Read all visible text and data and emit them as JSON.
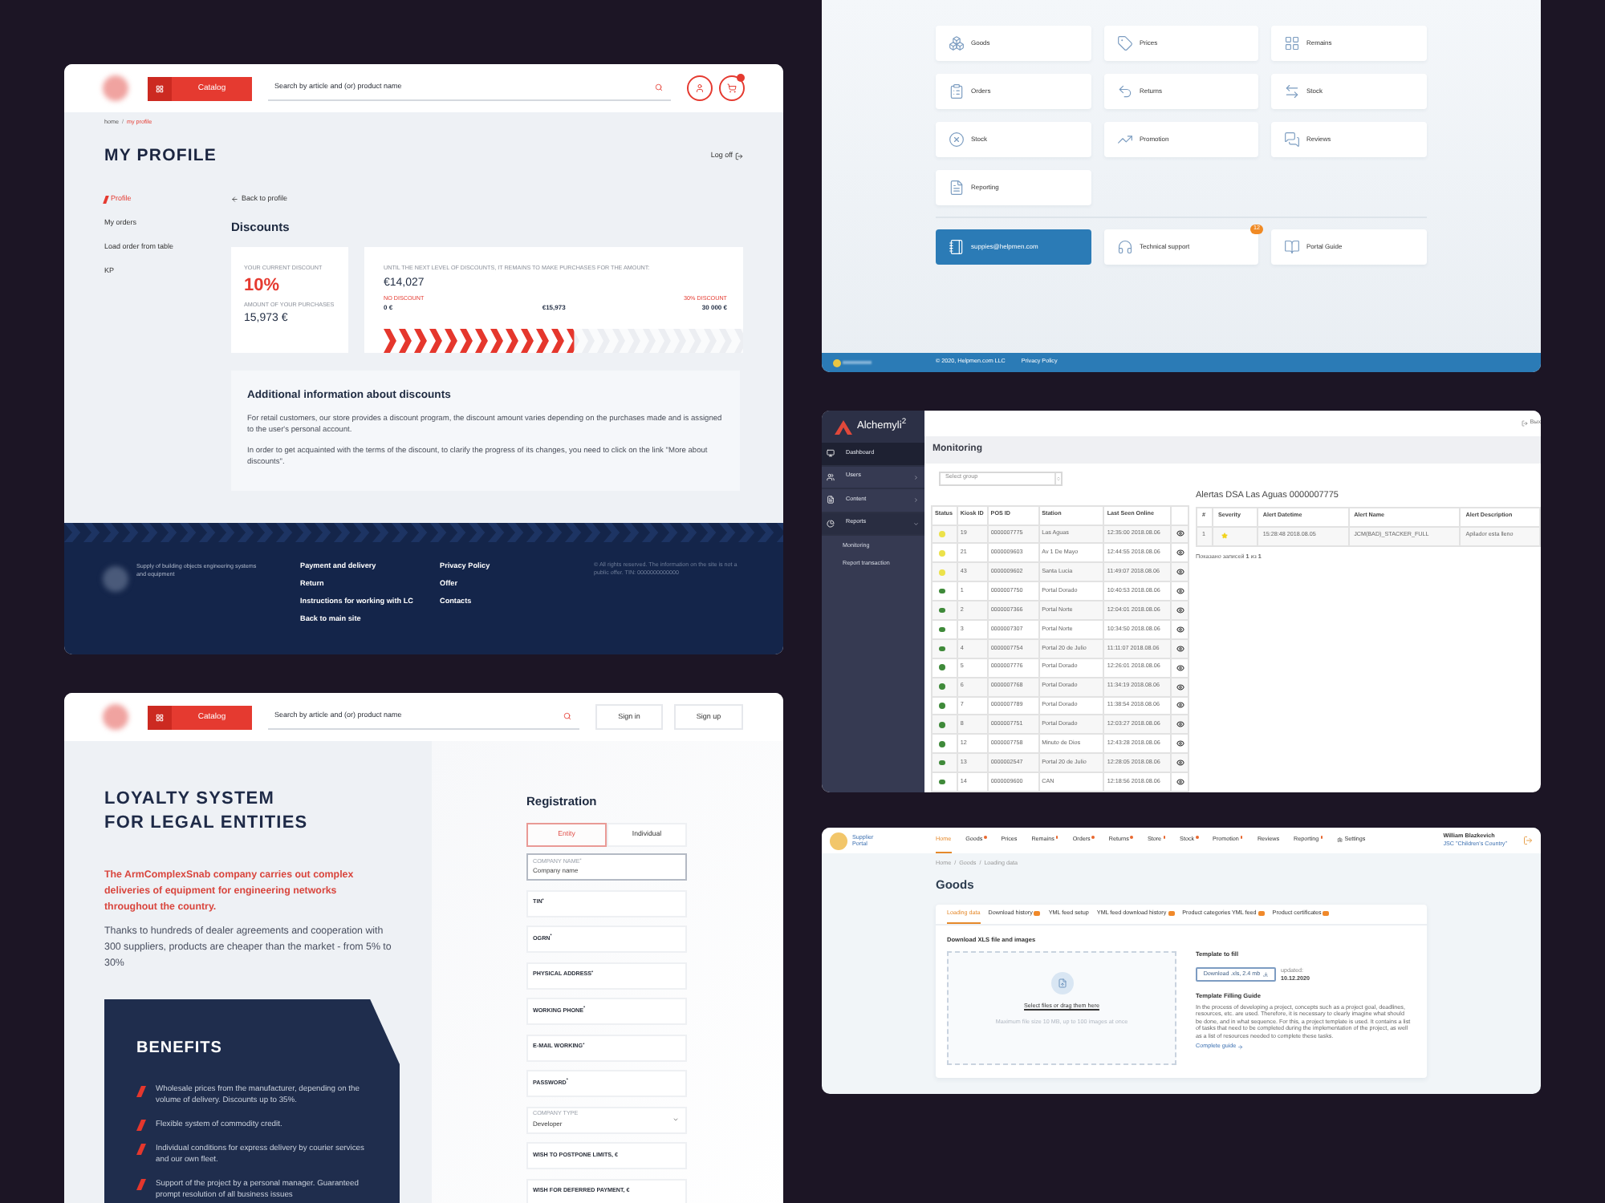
{
  "profile_page": {
    "header": {
      "catalog_button": "Catalog",
      "search": {
        "placeholder": "Search by article and (or) product name"
      }
    },
    "breadcrumb": {
      "separator": "/",
      "items": [
        {
          "label": "home",
          "selected": false
        },
        {
          "label": "my profile",
          "selected": true
        }
      ]
    },
    "title": "MY PROFILE",
    "log_off": "Log off",
    "sidebar": [
      {
        "label": "Profile",
        "selected": true
      },
      {
        "label": "My orders",
        "selected": false
      },
      {
        "label": "Load order from table",
        "selected": false
      },
      {
        "label": "KP",
        "selected": false
      }
    ],
    "back_link": "Back to profile",
    "section_title": "Discounts",
    "current_discount": {
      "label": "YOUR CURRENT DISCOUNT",
      "value": "10%",
      "purchases_label": "AMOUNT OF YOUR PURCHASES",
      "purchases": "15,973 €"
    },
    "next_level": {
      "label": "UNTIL THE NEXT LEVEL OF DISCOUNTS, IT REMAINS TO MAKE PURCHASES FOR THE AMOUNT:",
      "amount": "€14,027",
      "start_label": "NO DISCOUNT",
      "start_value": "0 €",
      "current_value": "€15,973",
      "end_label": "30% DISCOUNT",
      "end_value": "30 000 €",
      "level": 0.53
    },
    "info": {
      "title": "Additional information about discounts",
      "paragraphs": [
        "For retail customers, our store provides a discount program, the discount amount varies depending on the purchases made and is assigned to the user's personal account.",
        "In order to get acquainted with the terms of the discount, to clarify the progress of its changes, you need to click on the link \"More about discounts\"."
      ]
    },
    "footer": {
      "tagline": "Supply of building objects engineering systems and equipment",
      "link_columns": [
        [
          "Payment and delivery",
          "Return",
          "Instructions for working with LC",
          "Back to main site"
        ],
        [
          "Privacy Policy",
          "Offer",
          "Contacts"
        ]
      ],
      "copyright": "© All rights reserved. The information on the site is not a public offer. TIN: 0000000000000"
    }
  },
  "loyalty_page": {
    "header": {
      "catalog_button": "Catalog",
      "search": {
        "placeholder": "Search by article and (or) product name"
      },
      "sign_in": "Sign in",
      "sign_up": "Sign up"
    },
    "title_lines": [
      "LOYALTY SYSTEM",
      "FOR LEGAL ENTITIES"
    ],
    "lead": "The ArmComplexSnab company carries out complex deliveries of equipment for engineering networks throughout the country.",
    "text": "Thanks to hundreds of dealer agreements and cooperation with 300 suppliers, products are cheaper than the market - from 5% to 30%",
    "benefits": {
      "title": "BENEFITS",
      "items": [
        "Wholesale prices from the manufacturer, depending on the volume of delivery. Discounts up to 35%.",
        "Flexible system of commodity credit.",
        "Individual conditions for express delivery by courier services and our own fleet.",
        "Support of the project by a personal manager. Guaranteed prompt resolution of all business issues"
      ]
    },
    "registration": {
      "title": "Registration",
      "tabs": [
        {
          "label": "Entity",
          "selected": true
        },
        {
          "label": "Individual",
          "selected": false
        }
      ],
      "fields": [
        {
          "kind": "text",
          "label": "COMPANY NAME$^{*}$",
          "placeholder": "Company name",
          "focused": true
        },
        {
          "kind": "text",
          "label": "TIN$^{*}$",
          "focused": false
        },
        {
          "kind": "text",
          "label": "OGRN$^{*}$",
          "focused": false
        },
        {
          "kind": "text",
          "label": "PHYSICAL ADDRESS$^{*}$",
          "focused": false
        },
        {
          "kind": "text",
          "label": "WORKING PHONE$^{*}$",
          "focused": false
        },
        {
          "kind": "text",
          "label": "E-MAIL WORKING$^{*}$",
          "focused": false
        },
        {
          "kind": "text",
          "label": "PASSWORD$^{*}$",
          "focused": false
        },
        {
          "kind": "select",
          "label": "COMPANY TYPE",
          "value": "Developer"
        },
        {
          "kind": "text",
          "label": "WISH TO POSTPONE LIMITS, €",
          "focused": false
        },
        {
          "kind": "text",
          "label": "WISH FOR DEFERRED PAYMENT, €",
          "focused": false
        }
      ]
    }
  },
  "supplier_menu_page": {
    "tiles": [
      "Goods",
      "Prices",
      "Remains",
      "Orders",
      "Returns",
      "Stock",
      "Stock",
      "Promotion",
      "Reviews",
      "Reporting"
    ],
    "contacts": [
      {
        "kind": "email",
        "label": "suppies@helpmen.com"
      },
      {
        "kind": "link",
        "label": "Technical support",
        "badge": "12"
      },
      {
        "kind": "link",
        "label": "Portal Guide"
      }
    ],
    "footer": {
      "copyright": "© 2020, Helpmen.com LLC",
      "privacy_link": "Privacy Policy"
    }
  },
  "monitoring_page": {
    "brand": "Alchemyli$^{2}$",
    "exit": "Вых",
    "menu": [
      {
        "label": "Dashboard",
        "selected": true
      },
      {
        "label": "Users",
        "selected": false,
        "expanded": false
      },
      {
        "label": "Content",
        "selected": false,
        "expanded": false
      },
      {
        "label": "Reports",
        "selected": false,
        "expanded": true,
        "children": [
          {
            "label": "Monitoring"
          },
          {
            "label": "Report transaction"
          }
        ]
      }
    ],
    "title": "Monitoring",
    "group_select": {
      "placeholder": "Select group"
    },
    "kiosks": {
      "columns": [
        "Status",
        "Kiosk ID",
        "POS ID",
        "Station",
        "Last Seen Online"
      ],
      "rows": [
        {
          "color": "#ece24a",
          "kiosk_id": "19",
          "pos_id": "0000007775",
          "station": "Las Aguas",
          "last_seen": "12:35:00 2018.08.06"
        },
        {
          "color": "#ece24a",
          "kiosk_id": "21",
          "pos_id": "0000009603",
          "station": "Av 1 De Mayo",
          "last_seen": "12:44:55 2018.08.06"
        },
        {
          "color": "#ece24a",
          "kiosk_id": "43",
          "pos_id": "0000009602",
          "station": "Santa Lucia",
          "last_seen": "11:49:07 2018.08.06"
        },
        {
          "color": "#3f8a3a",
          "kiosk_id": "1",
          "pos_id": "0000007750",
          "station": "Portal Dorado",
          "last_seen": "10:40:53 2018.08.06"
        },
        {
          "color": "#3f8a3a",
          "kiosk_id": "2",
          "pos_id": "0000007366",
          "station": "Portal Norte",
          "last_seen": "12:04:01 2018.08.06"
        },
        {
          "color": "#3f8a3a",
          "kiosk_id": "3",
          "pos_id": "0000007307",
          "station": "Portal Norte",
          "last_seen": "10:34:50 2018.08.06"
        },
        {
          "color": "#3f8a3a",
          "kiosk_id": "4",
          "pos_id": "0000007754",
          "station": "Portal 20 de Julio",
          "last_seen": "11:11:07 2018.08.06"
        },
        {
          "color": "#3f8a3a",
          "kiosk_id": "5",
          "pos_id": "0000007776",
          "station": "Portal Dorado",
          "last_seen": "12:26:01 2018.08.06"
        },
        {
          "color": "#3f8a3a",
          "kiosk_id": "6",
          "pos_id": "0000007768",
          "station": "Portal Dorado",
          "last_seen": "11:34:19 2018.08.06"
        },
        {
          "color": "#3f8a3a",
          "kiosk_id": "7",
          "pos_id": "0000007789",
          "station": "Portal Dorado",
          "last_seen": "11:38:54 2018.08.06"
        },
        {
          "color": "#3f8a3a",
          "kiosk_id": "8",
          "pos_id": "0000007751",
          "station": "Portal Dorado",
          "last_seen": "12:03:27 2018.08.06"
        },
        {
          "color": "#3f8a3a",
          "kiosk_id": "12",
          "pos_id": "0000007758",
          "station": "Minuto de Dios",
          "last_seen": "12:43:28 2018.08.06"
        },
        {
          "color": "#3f8a3a",
          "kiosk_id": "13",
          "pos_id": "0000002547",
          "station": "Portal 20 de Julio",
          "last_seen": "12:28:05 2018.08.06"
        },
        {
          "color": "#3f8a3a",
          "kiosk_id": "14",
          "pos_id": "0000009600",
          "station": "CAN",
          "last_seen": "12:18:56 2018.08.06"
        }
      ]
    },
    "alerts": {
      "title": "Alertas DSA Las Aguas 0000007775",
      "columns": [
        "#",
        "Severity",
        "Alert Datetime",
        "Alert Name",
        "Alert Description"
      ],
      "rows": [
        {
          "number": "1",
          "color": "#f2d31c",
          "datetime": "15:28:48 2018.08.05",
          "name": "JCM(BAD)_STACKER_FULL",
          "description": "Apilador esta lleno"
        }
      ],
      "summary": "Показано записей **1** из **1**"
    }
  },
  "goods_page": {
    "brand": "Supplier Portal",
    "nav": [
      {
        "kind": "link",
        "label": "Home",
        "selected": true,
        "marker": false
      },
      {
        "kind": "link",
        "label": "Goods",
        "selected": false,
        "marker": true
      },
      {
        "kind": "link",
        "label": "Prices",
        "selected": false,
        "marker": false
      },
      {
        "kind": "link",
        "label": "Remains",
        "selected": false,
        "marker": true
      },
      {
        "kind": "link",
        "label": "Orders",
        "selected": false,
        "marker": true
      },
      {
        "kind": "link",
        "label": "Returns",
        "selected": false,
        "marker": true
      },
      {
        "kind": "link",
        "label": "Store",
        "selected": false,
        "marker": true
      },
      {
        "kind": "link",
        "label": "Stock",
        "selected": false,
        "marker": true
      },
      {
        "kind": "link",
        "label": "Promotion",
        "selected": false,
        "marker": true
      },
      {
        "kind": "link",
        "label": "Reviews",
        "selected": false,
        "marker": false
      },
      {
        "kind": "link",
        "label": "Reporting",
        "selected": false,
        "marker": true
      },
      {
        "kind": "settings",
        "label": "Settings",
        "selected": false,
        "marker": false
      }
    ],
    "user": {
      "name": "William Blazkevich",
      "company": "JSC \"Children's Country\""
    },
    "breadcrumb": {
      "separator": "/",
      "items": [
        "Home",
        "Goods",
        "Loading data"
      ]
    },
    "title": "Goods",
    "tabs": [
      {
        "label": "Loading data",
        "selected": true,
        "badge": false
      },
      {
        "label": "Download history",
        "selected": false,
        "badge": true
      },
      {
        "label": "YML feed setup",
        "selected": false,
        "badge": false
      },
      {
        "label": "YML feed download history",
        "selected": false,
        "badge": true
      },
      {
        "label": "Product categories YML feed",
        "selected": false,
        "badge": true
      },
      {
        "label": "Product certificates",
        "selected": false,
        "badge": true
      }
    ],
    "upload": {
      "title": "Download XLS file and images",
      "dropzone": {
        "link": "Select files or drag them here",
        "hint": "Maximum file size 10 MB, up to 100 images at once"
      },
      "template": {
        "title": "Template to fill",
        "button": "Download .xls, 2.4 mb",
        "updated_label": "updated:",
        "updated_date": "10.12.2020"
      },
      "guide": {
        "title": "Template Filling Guide",
        "text": "In the process of developing a project, concepts such as a project goal, deadlines, resources, etc. are used. Therefore, it is necessary to clearly imagine what should be done, and in what sequence. For this, a project template is used. It contains a list of tasks that need to be completed during the implementation of the project, as well as a list of resources needed to complete these tasks.",
        "link": "Complete guide"
      }
    }
  }
}
